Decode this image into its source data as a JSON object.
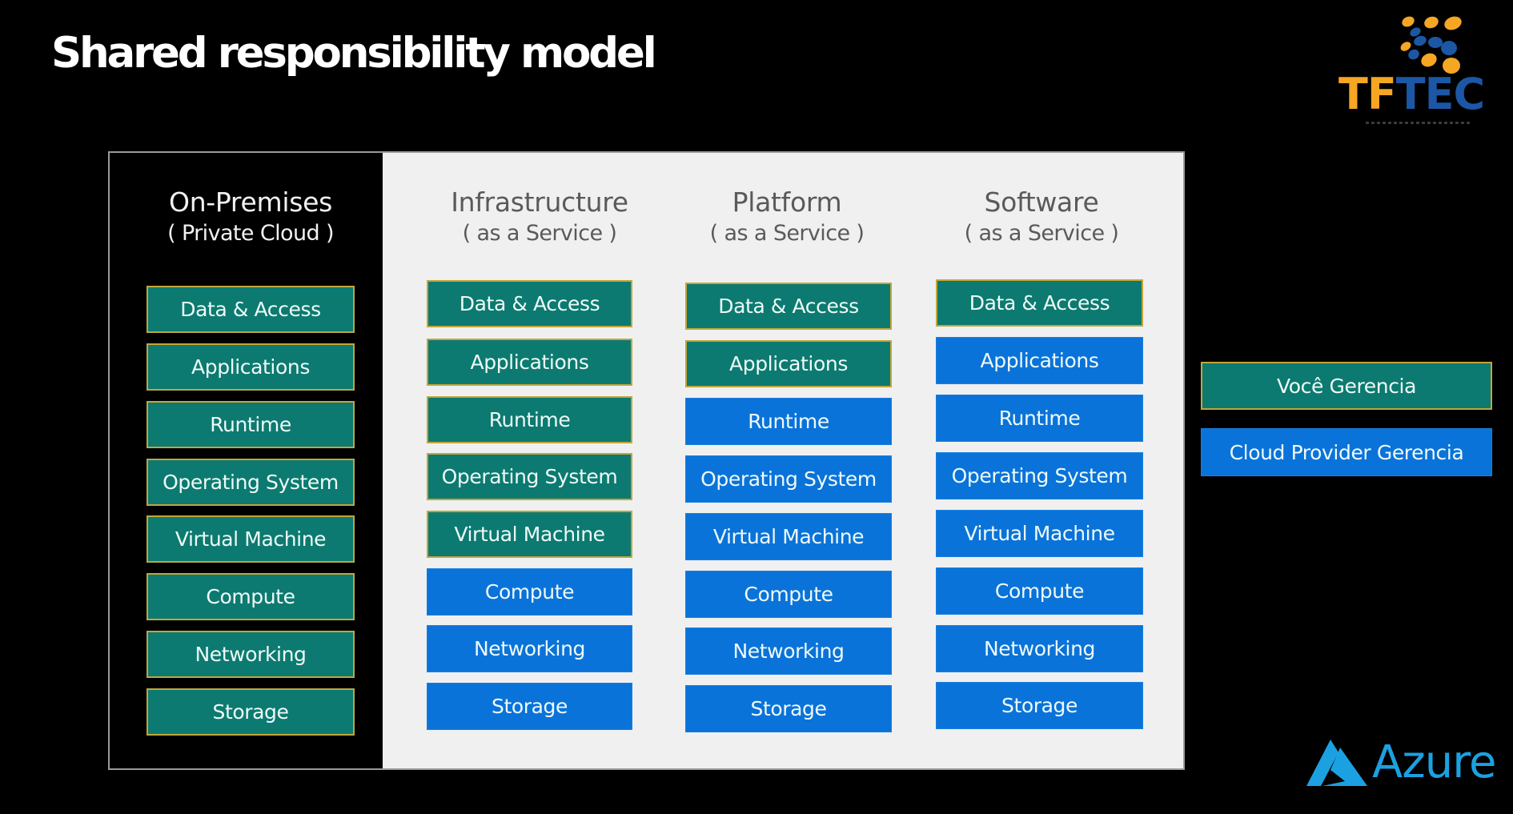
{
  "slide": {
    "title": "Shared responsibility model"
  },
  "colors": {
    "you_manage": "#0c7a70",
    "provider_manages": "#0a73d9",
    "you_manage_border": "#c2a63a",
    "azure_blue": "#1ba1e2",
    "tftec_orange": "#f5a623",
    "tftec_blue": "#1c57a5"
  },
  "columns": [
    {
      "id": "on-premises",
      "title": "On-Premises",
      "subtitle": "( Private Cloud )",
      "layers": [
        {
          "label": "Data & Access",
          "managed_by": "you"
        },
        {
          "label": "Applications",
          "managed_by": "you"
        },
        {
          "label": "Runtime",
          "managed_by": "you"
        },
        {
          "label": "Operating System",
          "managed_by": "you"
        },
        {
          "label": "Virtual Machine",
          "managed_by": "you"
        },
        {
          "label": "Compute",
          "managed_by": "you"
        },
        {
          "label": "Networking",
          "managed_by": "you"
        },
        {
          "label": "Storage",
          "managed_by": "you"
        }
      ]
    },
    {
      "id": "iaas",
      "title": "Infrastructure",
      "subtitle": "( as a Service )",
      "layers": [
        {
          "label": "Data & Access",
          "managed_by": "you"
        },
        {
          "label": "Applications",
          "managed_by": "you"
        },
        {
          "label": "Runtime",
          "managed_by": "you"
        },
        {
          "label": "Operating System",
          "managed_by": "you"
        },
        {
          "label": "Virtual Machine",
          "managed_by": "you"
        },
        {
          "label": "Compute",
          "managed_by": "provider"
        },
        {
          "label": "Networking",
          "managed_by": "provider"
        },
        {
          "label": "Storage",
          "managed_by": "provider"
        }
      ]
    },
    {
      "id": "paas",
      "title": "Platform",
      "subtitle": "( as a Service )",
      "layers": [
        {
          "label": "Data & Access",
          "managed_by": "you"
        },
        {
          "label": "Applications",
          "managed_by": "you"
        },
        {
          "label": "Runtime",
          "managed_by": "provider"
        },
        {
          "label": "Operating System",
          "managed_by": "provider"
        },
        {
          "label": "Virtual Machine",
          "managed_by": "provider"
        },
        {
          "label": "Compute",
          "managed_by": "provider"
        },
        {
          "label": "Networking",
          "managed_by": "provider"
        },
        {
          "label": "Storage",
          "managed_by": "provider"
        }
      ]
    },
    {
      "id": "saas",
      "title": "Software",
      "subtitle": "( as a Service )",
      "layers": [
        {
          "label": "Data & Access",
          "managed_by": "you"
        },
        {
          "label": "Applications",
          "managed_by": "provider"
        },
        {
          "label": "Runtime",
          "managed_by": "provider"
        },
        {
          "label": "Operating System",
          "managed_by": "provider"
        },
        {
          "label": "Virtual Machine",
          "managed_by": "provider"
        },
        {
          "label": "Compute",
          "managed_by": "provider"
        },
        {
          "label": "Networking",
          "managed_by": "provider"
        },
        {
          "label": "Storage",
          "managed_by": "provider"
        }
      ]
    }
  ],
  "legend": {
    "you": "Você Gerencia",
    "provider": "Cloud Provider Gerencia"
  },
  "logos": {
    "tftec": {
      "part1": "TF",
      "part2": "TEC",
      "icon": "tftec-dots-icon"
    },
    "azure": {
      "text": "Azure",
      "icon": "azure-triangle-icon"
    }
  }
}
